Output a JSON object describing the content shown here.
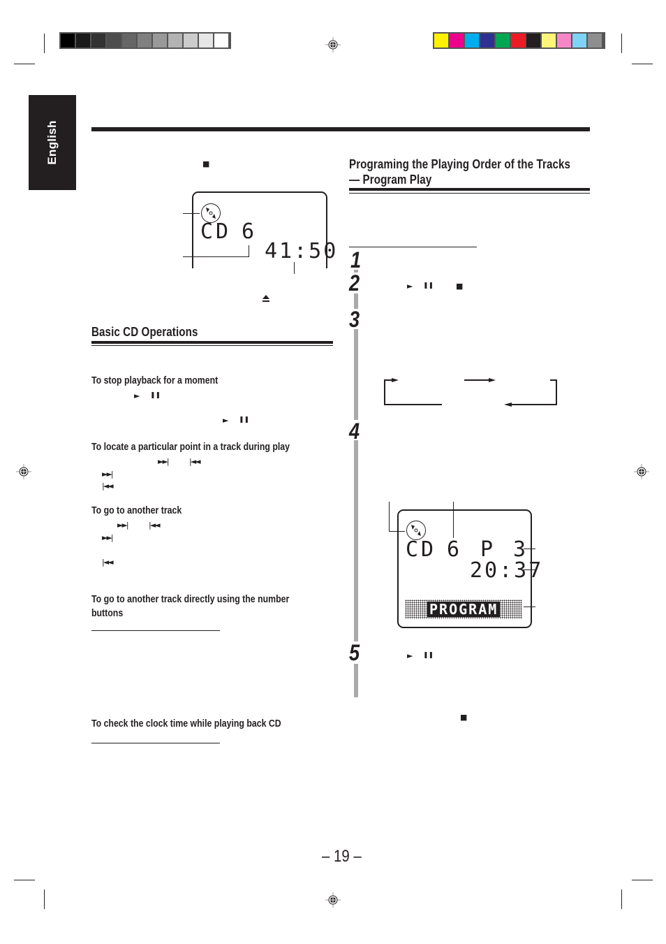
{
  "print_marks": {
    "grayscale_swatches": [
      "#000000",
      "#1a1a1a",
      "#333333",
      "#4d4d4d",
      "#666666",
      "#808080",
      "#999999",
      "#b3b3b3",
      "#cccccc",
      "#e6e6e6",
      "#ffffff"
    ],
    "color_swatches": [
      "#fff100",
      "#ec008c",
      "#00aeef",
      "#2e3192",
      "#00a651",
      "#ed1c24",
      "#231f20",
      "#fff57a",
      "#f587c6",
      "#7fd3f7",
      "#8e8e8e"
    ],
    "registration_icon": "crosshair-registration-icon"
  },
  "language_tab": {
    "label": "English"
  },
  "left_column": {
    "stop_symbol": "■",
    "display1": {
      "source": "CD",
      "track": "6",
      "time": "41:50",
      "disc_icon": "cd-disc-icon"
    },
    "eject_symbol": "⏏",
    "basic_ops": {
      "title": "Basic CD Operations",
      "sections": [
        {
          "heading": "To stop playback for a moment",
          "symbols": [
            "►",
            "❚❚",
            "►",
            "❚❚"
          ]
        },
        {
          "heading": "To locate a particular point in a track during play",
          "symbols": [
            "►►|",
            "|◄◄",
            "►►|",
            "|◄◄"
          ]
        },
        {
          "heading": "To go to another track",
          "symbols": [
            "►►|",
            "|◄◄",
            "►►|",
            "|◄◄"
          ]
        },
        {
          "heading": "To go to another track directly using the number buttons"
        },
        {
          "heading": "To check the clock time while playing back CD"
        }
      ]
    }
  },
  "right_column": {
    "title_line1": "Programing the Playing Order of the Tracks",
    "title_line2": "— Program Play",
    "steps": [
      {
        "number": "1"
      },
      {
        "number": "2",
        "symbols": [
          "►",
          "❚❚",
          "■"
        ]
      },
      {
        "number": "3"
      },
      {
        "number": "4"
      },
      {
        "number": "5",
        "symbols": [
          "►",
          "❚❚"
        ]
      }
    ],
    "display2": {
      "source": "CD",
      "track": "6",
      "program_label": "P",
      "program_step": "3",
      "time": "20:37",
      "mode_text": "PROGRAM",
      "disc_icon": "cd-disc-icon"
    },
    "stop_symbol": "■"
  },
  "footer": {
    "page_number": "– 19 –"
  }
}
